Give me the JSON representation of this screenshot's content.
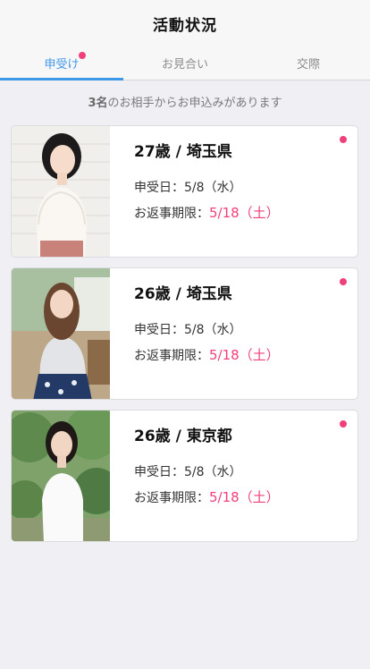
{
  "header": {
    "title": "活動状況"
  },
  "tabs": [
    {
      "label": "申受け",
      "active": true,
      "has_badge": true
    },
    {
      "label": "お見合い",
      "active": false,
      "has_badge": false
    },
    {
      "label": "交際",
      "active": false,
      "has_badge": false
    }
  ],
  "summary": {
    "count": "3名",
    "text": "のお相手からお申込みがあります"
  },
  "colors": {
    "accent": "#3f97e8",
    "badge": "#f0407a",
    "deadline": "#f0407a"
  },
  "cards": [
    {
      "heading": "27歳 / 埼玉県",
      "received_label": "申受日：",
      "received_date": "5/8（水）",
      "deadline_label": "お返事期限：",
      "deadline_date": "5/18（土）",
      "photo": "profile-photo"
    },
    {
      "heading": "26歳 / 埼玉県",
      "received_label": "申受日：",
      "received_date": "5/8（水）",
      "deadline_label": "お返事期限：",
      "deadline_date": "5/18（土）",
      "photo": "profile-photo"
    },
    {
      "heading": "26歳 / 東京都",
      "received_label": "申受日：",
      "received_date": "5/8（水）",
      "deadline_label": "お返事期限：",
      "deadline_date": "5/18（土）",
      "photo": "profile-photo"
    }
  ]
}
